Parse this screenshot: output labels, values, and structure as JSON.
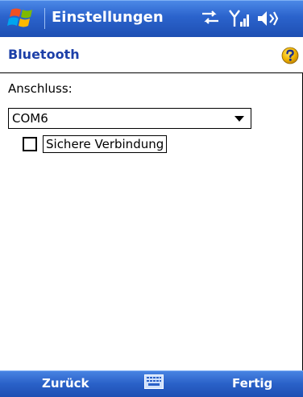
{
  "app": {
    "title": "Einstellungen",
    "page_title": "Bluetooth"
  },
  "status_icons": [
    "connectivity-icon",
    "signal-strength-icon",
    "volume-icon"
  ],
  "form": {
    "port_label": "Anschluss:",
    "port_value": "COM6",
    "secure_label": "Sichere Verbindung",
    "secure_checked": false
  },
  "menubar": {
    "left_label": "Zurück",
    "right_label": "Fertig"
  },
  "colors": {
    "bar_blue": "#2b63cc",
    "title_blue": "#1c3fa8"
  }
}
